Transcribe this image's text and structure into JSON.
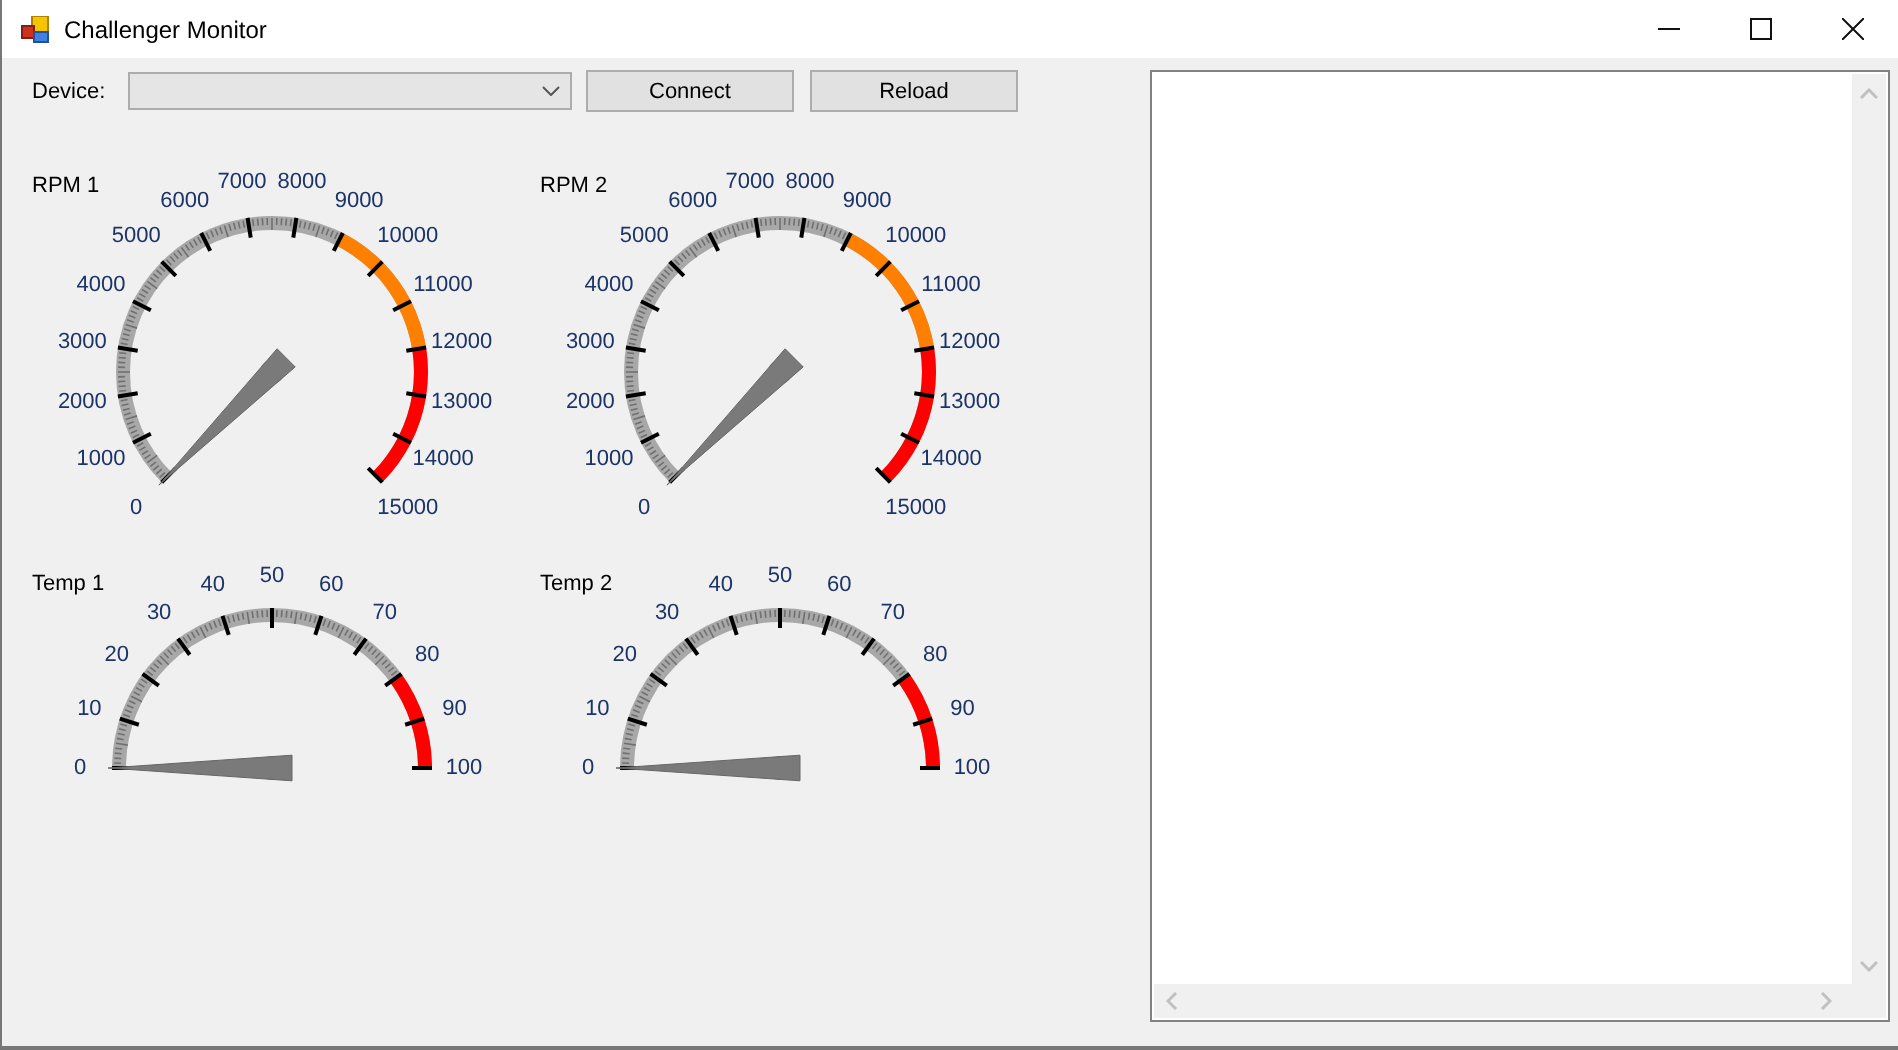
{
  "window": {
    "title": "Challenger Monitor"
  },
  "toolbar": {
    "device_label": "Device:",
    "buttons": [
      "Connect",
      "Reload"
    ]
  },
  "gauges": [
    {
      "kind": "rpm",
      "label": "RPM 1",
      "ticks": [
        {
          "label": "0"
        },
        {
          "label": "1000"
        },
        {
          "label": "2000"
        },
        {
          "label": "3000"
        },
        {
          "label": "4000"
        },
        {
          "label": "5000"
        },
        {
          "label": "6000"
        },
        {
          "label": "7000"
        },
        {
          "label": "8000"
        },
        {
          "label": "9000",
          "color": "#ff8000"
        },
        {
          "label": "10000",
          "color": "#ff8000"
        },
        {
          "label": "11000",
          "color": "#ff8000"
        },
        {
          "label": "12000",
          "color": "#ff0000"
        },
        {
          "label": "13000",
          "color": "#ff0000"
        },
        {
          "label": "14000",
          "color": "#ff0000"
        },
        {
          "label": "15000"
        }
      ]
    },
    {
      "kind": "rpm",
      "label": "RPM 2",
      "ticks": [
        {
          "label": "0"
        },
        {
          "label": "1000"
        },
        {
          "label": "2000"
        },
        {
          "label": "3000"
        },
        {
          "label": "4000"
        },
        {
          "label": "5000"
        },
        {
          "label": "6000"
        },
        {
          "label": "7000"
        },
        {
          "label": "8000"
        },
        {
          "label": "9000",
          "color": "#ff8000"
        },
        {
          "label": "10000",
          "color": "#ff8000"
        },
        {
          "label": "11000",
          "color": "#ff8000"
        },
        {
          "label": "12000",
          "color": "#ff0000"
        },
        {
          "label": "13000",
          "color": "#ff0000"
        },
        {
          "label": "14000",
          "color": "#ff0000"
        },
        {
          "label": "15000"
        }
      ]
    },
    {
      "kind": "temp",
      "label": "Temp 1",
      "ticks": [
        {
          "label": "0"
        },
        {
          "label": "10"
        },
        {
          "label": "20"
        },
        {
          "label": "30"
        },
        {
          "label": "40"
        },
        {
          "label": "50"
        },
        {
          "label": "60"
        },
        {
          "label": "70"
        },
        {
          "label": "80",
          "color": "#ff0000"
        },
        {
          "label": "90",
          "color": "#ff0000"
        },
        {
          "label": "100"
        }
      ]
    },
    {
      "kind": "temp",
      "label": "Temp 2",
      "ticks": [
        {
          "label": "0"
        },
        {
          "label": "10"
        },
        {
          "label": "20"
        },
        {
          "label": "30"
        },
        {
          "label": "40"
        },
        {
          "label": "50"
        },
        {
          "label": "60"
        },
        {
          "label": "70"
        },
        {
          "label": "80",
          "color": "#ff0000"
        },
        {
          "label": "90",
          "color": "#ff0000"
        },
        {
          "label": "100"
        }
      ]
    }
  ]
}
